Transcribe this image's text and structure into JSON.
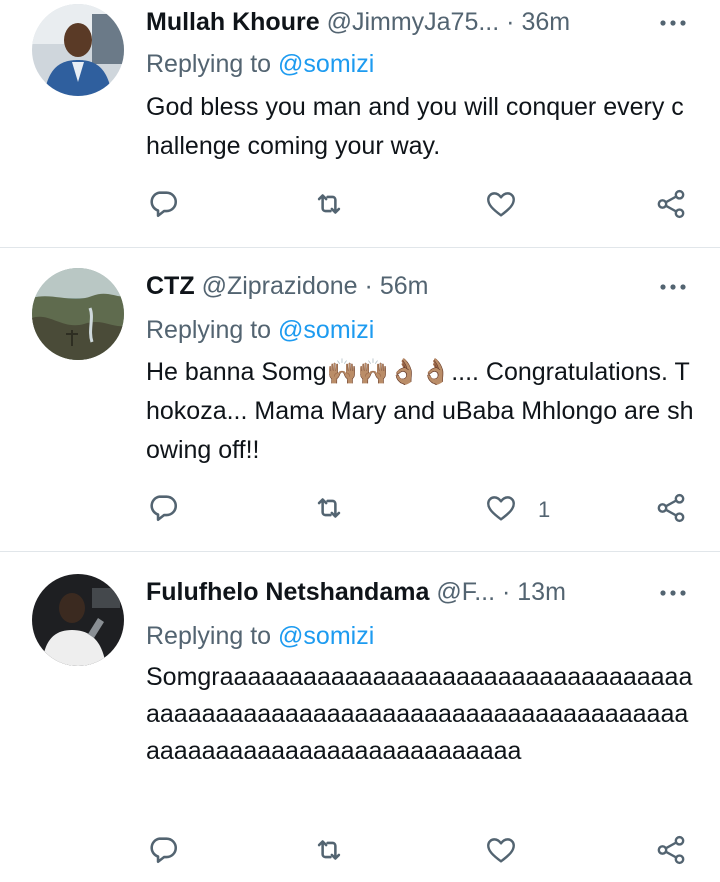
{
  "tweets": [
    {
      "name": "Mullah Khoure",
      "handle": "@JimmyJa75...",
      "dot": "·",
      "time": "36m",
      "replying_prefix": "Replying to",
      "replying_to": "@somizi",
      "text": "God bless you man and you will conquer every challenge coming your way.",
      "like_count": ""
    },
    {
      "name": "CTZ",
      "handle": "@Ziprazidone",
      "dot": "·",
      "time": "56m",
      "replying_prefix": "Replying to",
      "replying_to": "@somizi",
      "text": "He banna Somg🙌🏽🙌🏽👌🏽👌🏽.... Congratulations. Thokoza... Mama Mary and uBaba Mhlongo are showing off!!",
      "like_count": "1"
    },
    {
      "name": "Fulufhelo Netshandama",
      "handle": "@F...",
      "dot": "·",
      "time": "13m",
      "replying_prefix": "Replying to",
      "replying_to": "@somizi",
      "text": "Somgraaaaaaaaaaaaaaaaaaaaaaaaaaaaaaaaaaaaaaaaaaaaaaaaaaaaaaaaaaaaaaaaaaaaaaaaaaaaaaaaaaaaaaaaaaaaaaaaaaaa",
      "like_count": ""
    }
  ],
  "icons": {
    "more": "more-horizontal-icon",
    "reply": "reply-bubble-icon",
    "retweet": "retweet-icon",
    "like": "heart-icon",
    "share": "share-icon"
  },
  "colors": {
    "text": "#0f1419",
    "secondary": "#536471",
    "link": "#1d9bf0",
    "divider": "#e1e6ea"
  }
}
